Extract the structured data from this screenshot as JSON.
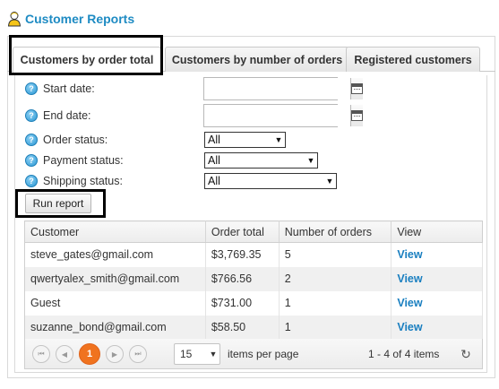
{
  "header": {
    "title": "Customer Reports",
    "icon": "person-icon"
  },
  "tabs": [
    {
      "label": "Customers by order total",
      "active": true
    },
    {
      "label": "Customers by number of orders",
      "active": false
    },
    {
      "label": "Registered customers",
      "active": false
    }
  ],
  "filters": {
    "start_date": {
      "label": "Start date:",
      "value": "",
      "icon": "calendar-icon"
    },
    "end_date": {
      "label": "End date:",
      "value": "",
      "icon": "calendar-icon"
    },
    "order_status": {
      "label": "Order status:",
      "value": "All"
    },
    "payment_status": {
      "label": "Payment status:",
      "value": "All"
    },
    "shipping_status": {
      "label": "Shipping status:",
      "value": "All"
    },
    "help_icon": "?"
  },
  "run_button": "Run report",
  "grid": {
    "columns": [
      "Customer",
      "Order total",
      "Number of orders",
      "View"
    ],
    "rows": [
      {
        "customer": "steve_gates@gmail.com",
        "order_total": "$3,769.35",
        "orders": "5",
        "view": "View"
      },
      {
        "customer": "qwertyalex_smith@gmail.com",
        "order_total": "$766.56",
        "orders": "2",
        "view": "View"
      },
      {
        "customer": "Guest",
        "order_total": "$731.00",
        "orders": "1",
        "view": "View"
      },
      {
        "customer": "suzanne_bond@gmail.com",
        "order_total": "$58.50",
        "orders": "1",
        "view": "View"
      }
    ]
  },
  "pager": {
    "current_page": "1",
    "page_size": "15",
    "per_page_label": "items per page",
    "summary": "1 - 4 of 4 items",
    "first_icon": "⏮",
    "prev_icon": "◀",
    "next_icon": "▶",
    "last_icon": "⏭",
    "refresh_icon": "↻"
  },
  "colors": {
    "accent": "#1E8BC3",
    "current_page": "#F0731F",
    "link": "#1A7FC0"
  }
}
